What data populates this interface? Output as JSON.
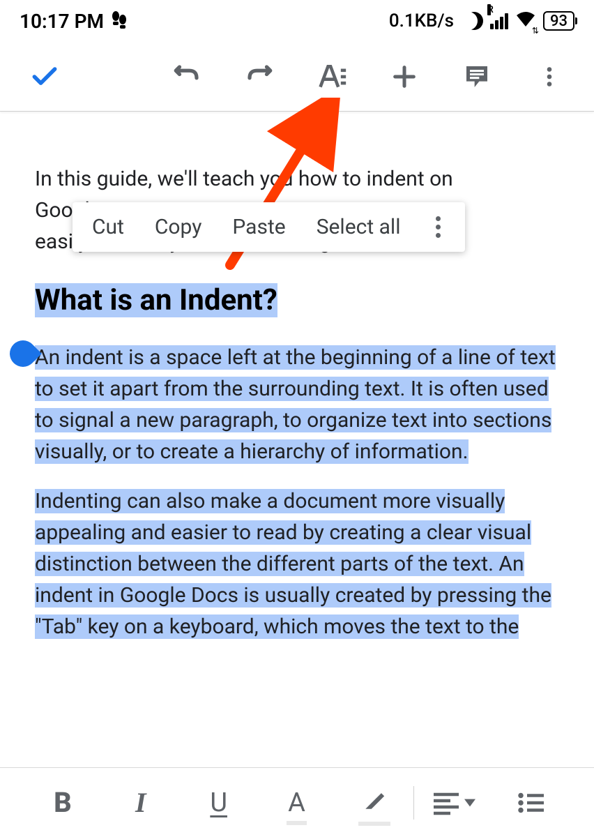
{
  "status": {
    "time": "10:17 PM",
    "speed": "0.1KB/s",
    "signal_label": "R",
    "battery": "93"
  },
  "context_menu": {
    "cut": "Cut",
    "copy": "Copy",
    "paste": "Paste",
    "select_all": "Select all"
  },
  "document": {
    "intro_line1": "In this guide, we'll teach you how to indent on",
    "intro_line2": "Google Docs so you can format your text",
    "intro_line3": "easily. Format your text on the go!",
    "heading": "What is an Indent?",
    "para1": "An indent is a space left at the beginning of a line of text to set it apart from the surrounding text. It is often used to signal a new paragraph, to organize text into sections visually, or to create a hierarchy of information.",
    "para2": "Indenting can also make a document more visually appealing and easier to read by creating a clear visual distinction between the different parts of the text. An indent in Google Docs is usually created by pressing the \"Tab\" key on a keyboard, which moves the text to the"
  },
  "bottom_toolbar": {
    "bold": "B",
    "italic": "I",
    "underline": "U",
    "text_color": "A"
  }
}
